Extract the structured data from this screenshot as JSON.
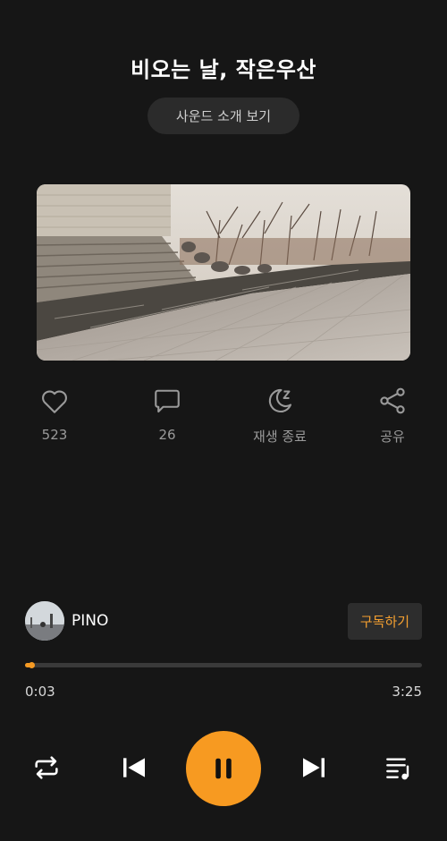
{
  "track": {
    "title": "비오는 날, 작은우산"
  },
  "sound_button": {
    "label": "사운드 소개 보기"
  },
  "actions": [
    {
      "icon": "heart-icon",
      "label": "523"
    },
    {
      "icon": "comment-icon",
      "label": "26"
    },
    {
      "icon": "sleep-timer-icon",
      "label": "재생 종료"
    },
    {
      "icon": "share-icon",
      "label": "공유"
    }
  ],
  "artist": {
    "name": "PINO",
    "subscribe_label": "구독하기"
  },
  "playback": {
    "elapsed": "0:03",
    "total": "3:25",
    "progress": 0.015,
    "state": "playing"
  },
  "colors": {
    "accent": "#f79a21",
    "background": "#161616"
  }
}
